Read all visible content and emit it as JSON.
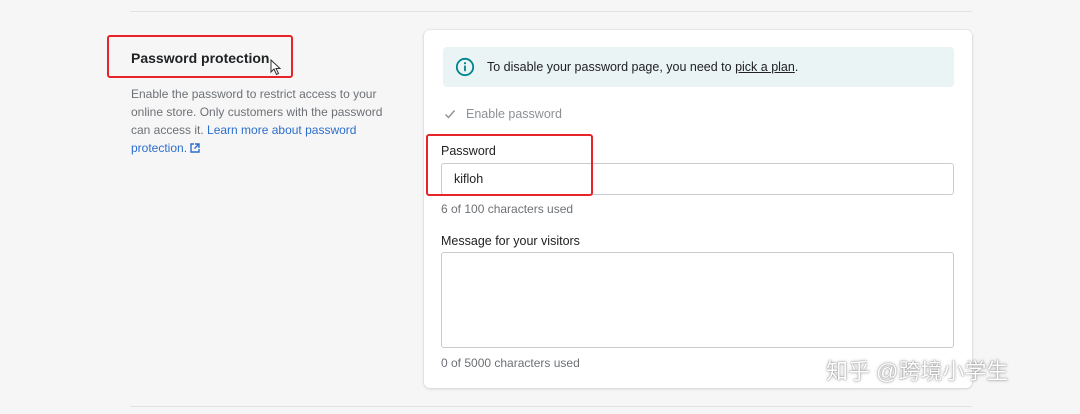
{
  "section": {
    "title": "Password protection",
    "description_text": "Enable the password to restrict access to your online store. Only customers with the password can access it. ",
    "description_link": "Learn more about password protection."
  },
  "banner": {
    "text": "To disable your password page, you need to ",
    "link": "pick a plan",
    "suffix": "."
  },
  "enable_password": {
    "label": "Enable password",
    "checked": true
  },
  "password": {
    "label": "Password",
    "value": "kifloh",
    "helper": "6 of 100 characters used"
  },
  "message": {
    "label": "Message for your visitors",
    "value": "",
    "helper": "0 of 5000 characters used"
  },
  "watermark": {
    "text": "知乎 @跨境小学生"
  },
  "colors": {
    "highlight": "#e8242b",
    "link": "#2c6ecb",
    "banner_bg": "#eaf4f5",
    "info_icon": "#00848e"
  }
}
